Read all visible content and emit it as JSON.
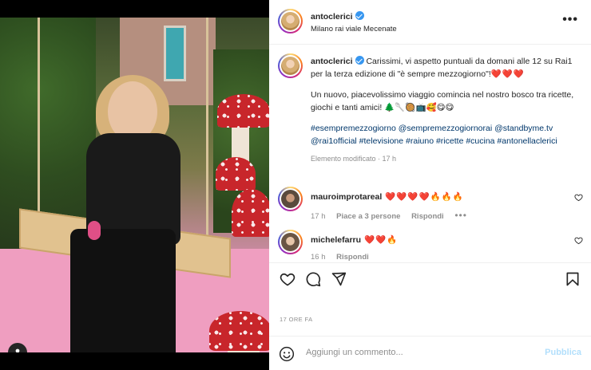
{
  "post": {
    "username": "antoclerici",
    "location": "Milano rai viale Mecenate",
    "more_label": "•••"
  },
  "caption": {
    "username": "antoclerici",
    "paragraph1": "Carissimi, vi aspetto puntuali da domani alle 12 su Rai1 per la terza edizione di \"è sempre mezzogiorno\"!",
    "paragraph1_emoji": "❤️❤️❤️",
    "paragraph2": "Un nuovo, piacevolissimo viaggio comincia nel nostro bosco tra ricette, giochi e tanti amici!",
    "paragraph2_emoji": "🌲🥄🥘📺🥰😋😋",
    "hashtags": "#esempremezzogiorno @sempremezzogiornorai @standbyme.tv @rai1official #televisione #raiuno #ricette #cucina #antonellaclerici",
    "edited": "Elemento modificato · 17 h"
  },
  "comments": [
    {
      "username": "mauroimprotareal",
      "text": "❤️❤️❤️❤️🔥🔥🔥",
      "time": "17 h",
      "likes": "Piace a 3 persone",
      "reply": "Rispondi",
      "more": "•••"
    },
    {
      "username": "michelefarru",
      "text": "❤️❤️🔥",
      "time": "16 h",
      "reply": "Rispondi"
    }
  ],
  "timestamp": "17 ORE FA",
  "add_comment": {
    "placeholder": "Aggiungi un commento...",
    "post_label": "Pubblica"
  },
  "colors": {
    "accent": "#3897f0",
    "heart": "#ed4956",
    "link": "#00376b",
    "post_disabled": "#b2dffc"
  },
  "icons": {
    "like": "heart-outline-icon",
    "comment": "comment-bubble-icon",
    "share": "paper-plane-icon",
    "save": "bookmark-icon",
    "emoji": "smiley-icon",
    "tag": "user-tag-icon"
  }
}
